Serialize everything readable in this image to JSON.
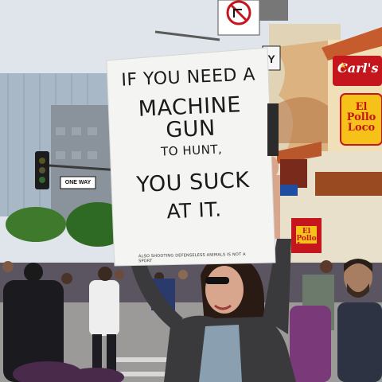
{
  "sign": {
    "line1": "IF YOU NEED A",
    "line2": "MACHINE GUN",
    "line3": "TO HUNT,",
    "line4": "YOU SUCK",
    "line5": "AT IT.",
    "fine_print": "ALSO SHOOTING DEFENSELESS ANIMALS IS NOT A SPORT"
  },
  "storefront": {
    "carls_logo": "Carl's",
    "pollo_loco_logo": "El Pollo Loco",
    "pollo_loco_small": "El Pollo Loco"
  },
  "street": {
    "one_way_sign": "ONE WAY",
    "partial_sign_letter": "Y"
  },
  "colors": {
    "sign_board": "#f4f4f2",
    "carls_red": "#c4161c",
    "pollo_yellow": "#f6c21a",
    "sky": "#dfe5ea"
  }
}
